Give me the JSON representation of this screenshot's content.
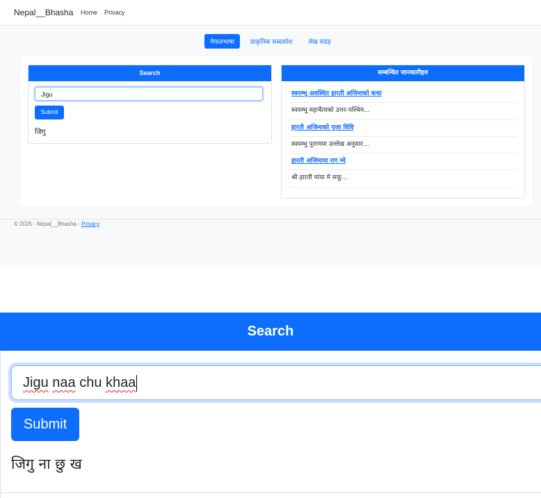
{
  "navbar": {
    "brand": "Nepal__Bhasha",
    "links": [
      "Home",
      "Privacy"
    ]
  },
  "tabs": [
    {
      "label": "नेपालभाषा",
      "active": true
    },
    {
      "label": "प्राकृतिक सब्दकोश",
      "active": false
    },
    {
      "label": "लेख संग्रह",
      "active": false
    }
  ],
  "search_card": {
    "title": "Search",
    "input_value": "Jigu",
    "submit_label": "Submit",
    "result": "जिगु"
  },
  "related_card": {
    "title": "सम्बन्धित जानकारीहरु",
    "items": [
      {
        "text": "स्वयम्भु अवस्थित हारती अजिमाको कथा",
        "link": true
      },
      {
        "text": "स्वयम्भू महाचैत्यको उत्तर-पश्चिम...",
        "link": false
      },
      {
        "text": "हारती अजिमाको पुजा विधि",
        "link": true
      },
      {
        "text": "स्वयम्भु पुराणमा उल्लेख अनुसार...",
        "link": false
      },
      {
        "text": "हारती अजिमाया राग म्ये",
        "link": true
      },
      {
        "text": "श्री हारती मांया मे सफू...",
        "link": false
      }
    ]
  },
  "footer": {
    "prefix": "© 2025 - Nepal__Bhasha - ",
    "privacy_link": "Privacy"
  },
  "zoom": {
    "title": "Search",
    "input_words": [
      "Jigu",
      "naa",
      "chu",
      "khaa"
    ],
    "submit_label": "Submit",
    "result": "जिगु ना छु ख"
  },
  "colors": {
    "primary": "#0d6efd",
    "page_bg": "#f8f9fa"
  }
}
